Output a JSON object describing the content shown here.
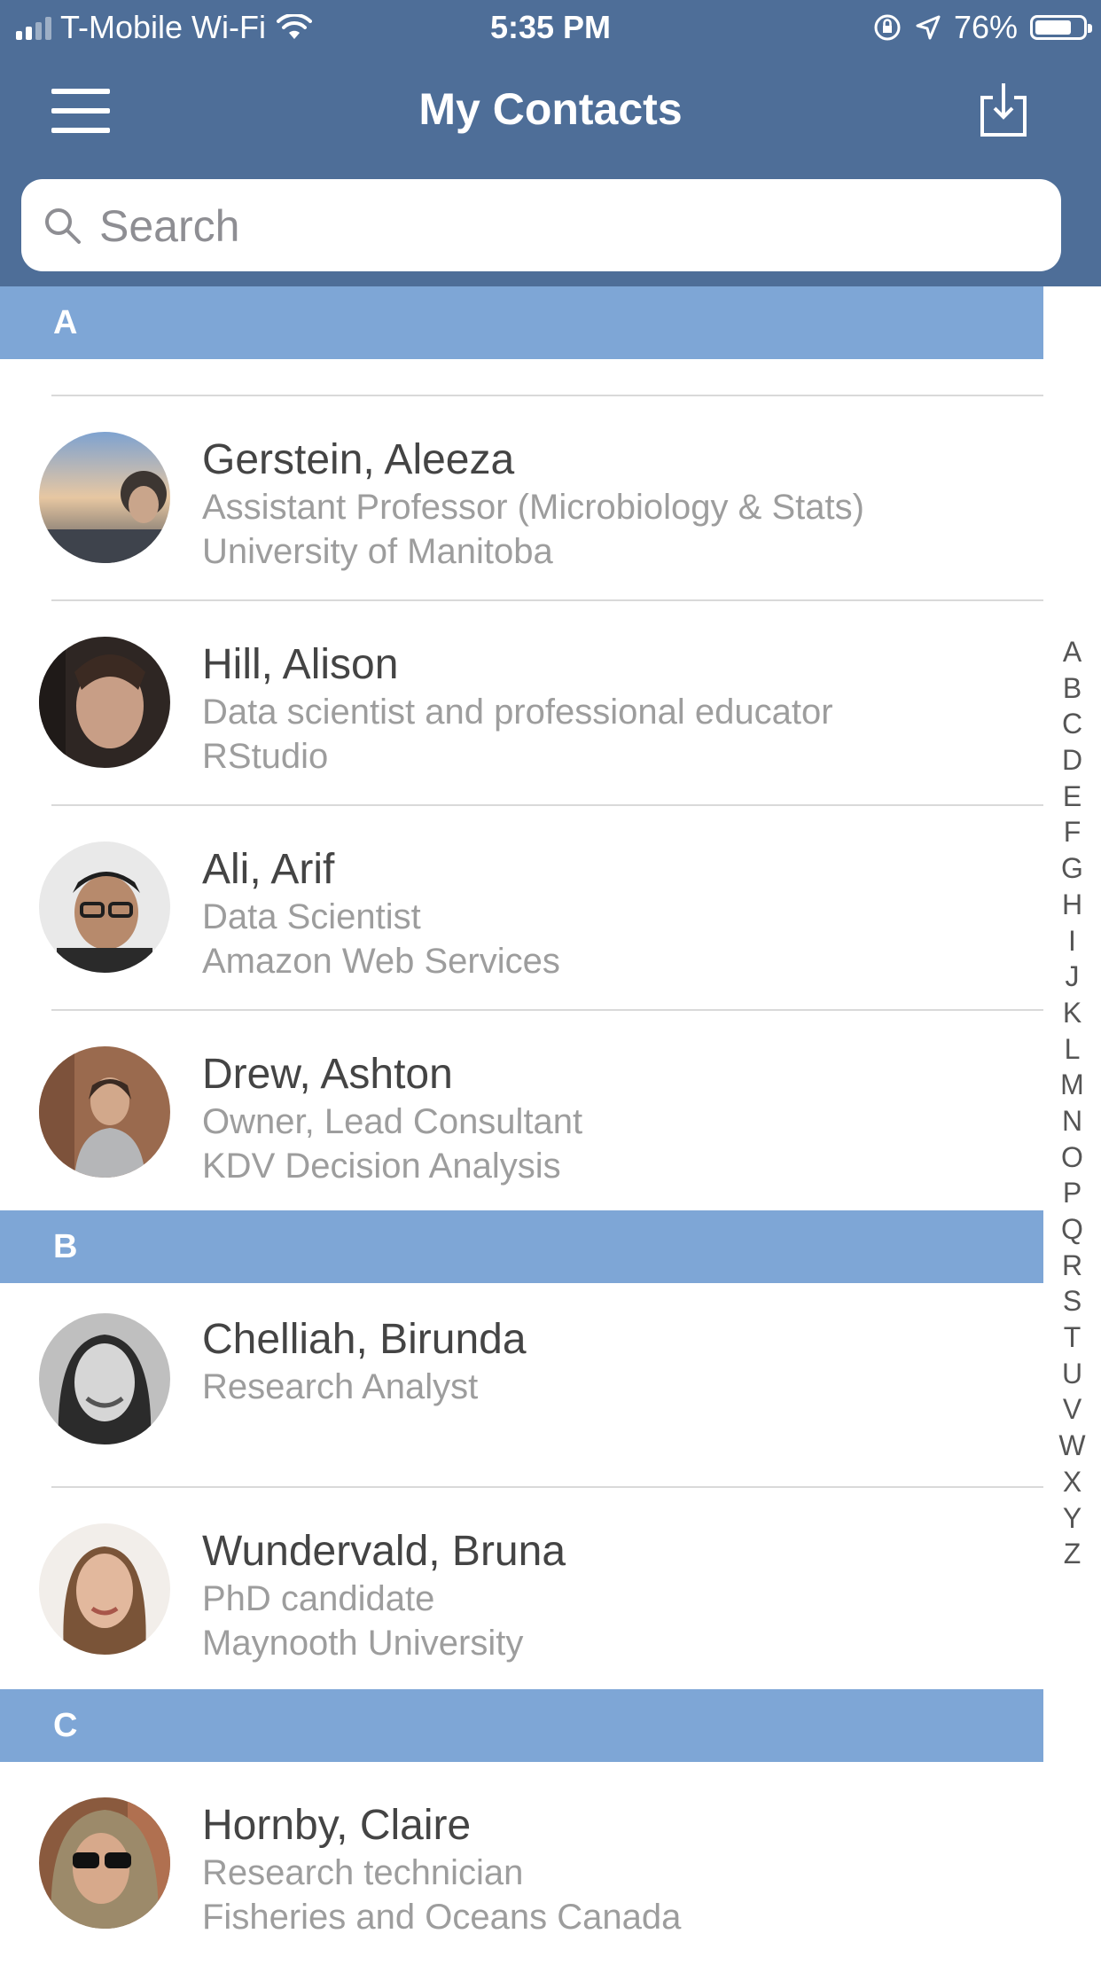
{
  "status_bar": {
    "carrier": "T-Mobile Wi-Fi",
    "time": "5:35 PM",
    "battery": "76%",
    "battery_level": 0.76
  },
  "nav": {
    "title": "My Contacts",
    "menu_icon": "hamburger-menu-icon",
    "export_icon": "export-download-icon"
  },
  "search": {
    "placeholder": "Search",
    "value": ""
  },
  "colors": {
    "header": "#4e6e98",
    "section": "#7ea6d6",
    "name": "#444444",
    "detail": "#9d9d9d"
  },
  "sections": [
    {
      "letter": "A",
      "contacts": [
        {
          "name": "",
          "line1": "",
          "line2": ""
        },
        {
          "name": "Gerstein, Aleeza",
          "line1": "Assistant Professor (Microbiology & Stats)",
          "line2": "University of Manitoba"
        },
        {
          "name": "Hill, Alison",
          "line1": "Data scientist and professional educator",
          "line2": "RStudio"
        },
        {
          "name": "Ali, Arif",
          "line1": "Data Scientist",
          "line2": "Amazon Web Services"
        },
        {
          "name": "Drew, Ashton",
          "line1": "Owner, Lead Consultant",
          "line2": "KDV Decision Analysis"
        }
      ]
    },
    {
      "letter": "B",
      "contacts": [
        {
          "name": "Chelliah, Birunda",
          "line1": "Research Analyst",
          "line2": ""
        },
        {
          "name": "Wundervald, Bruna",
          "line1": "PhD candidate",
          "line2": "Maynooth University"
        }
      ]
    },
    {
      "letter": "C",
      "contacts": [
        {
          "name": "Hornby, Claire",
          "line1": "Research technician",
          "line2": "Fisheries and Oceans Canada"
        }
      ]
    }
  ],
  "index_letters": [
    "A",
    "B",
    "C",
    "D",
    "E",
    "F",
    "G",
    "H",
    "I",
    "J",
    "K",
    "L",
    "M",
    "N",
    "O",
    "P",
    "Q",
    "R",
    "S",
    "T",
    "U",
    "V",
    "W",
    "X",
    "Y",
    "Z"
  ]
}
